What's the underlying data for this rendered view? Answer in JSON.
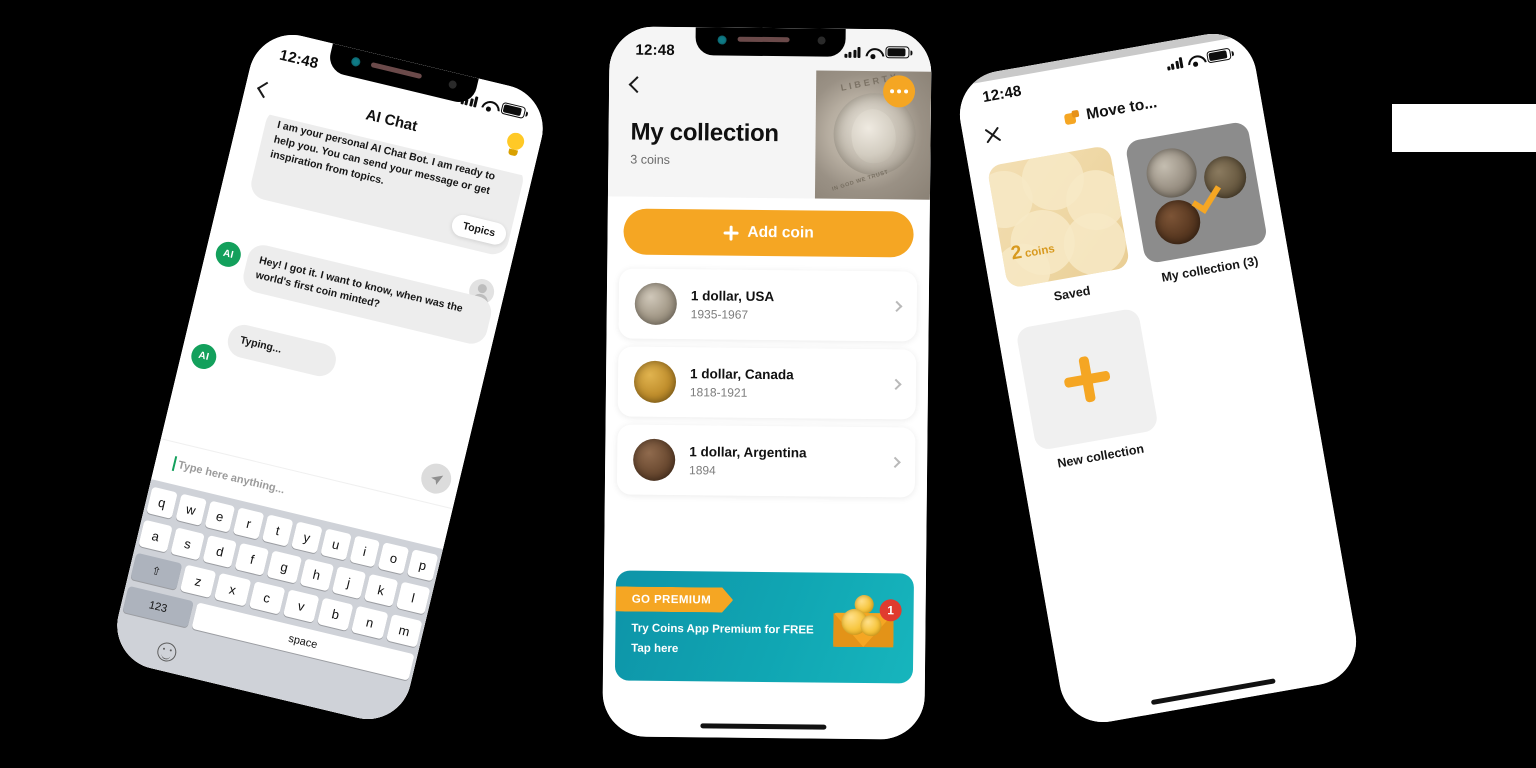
{
  "meta": {
    "background": "#000000",
    "accent_orange": "#F5A623",
    "accent_teal": "#10A6B3",
    "accent_green": "#13A05C"
  },
  "phone1": {
    "status": {
      "time": "12:48"
    },
    "header": {
      "title": "AI Chat",
      "back_icon": "chevron-left-icon",
      "bulb_icon": "lightbulb-icon"
    },
    "messages": [
      {
        "sender": "bot",
        "text": "I am your personal AI Chat Bot. I am ready to help you. You can send your message or get inspiration from topics."
      },
      {
        "sender": "user",
        "text": "Hey! I got it. I want to know, when was the world's first coin minted?"
      },
      {
        "sender": "bot",
        "text": "Typing..."
      }
    ],
    "topics_label": "Topics",
    "avatar_label": "AI",
    "input": {
      "placeholder": "Type here anything...",
      "value": ""
    },
    "send_icon": "send-paper-plane-icon",
    "keyboard": {
      "row1": [
        "q",
        "w",
        "e",
        "r",
        "t",
        "y",
        "u",
        "i",
        "o",
        "p"
      ],
      "row2": [
        "a",
        "s",
        "d",
        "f",
        "g",
        "h",
        "j",
        "k",
        "l"
      ],
      "row3": [
        "z",
        "x",
        "c",
        "v",
        "b",
        "n",
        "m"
      ],
      "shift_label": "⇧",
      "numbers_label": "123",
      "space_label": "space",
      "emoji_icon": "emoji-smiley-icon"
    }
  },
  "phone2": {
    "status": {
      "time": "12:48"
    },
    "back_icon": "chevron-left-icon",
    "more_icon": "more-horizontal-icon",
    "title": "My collection",
    "subtitle": "3 coins",
    "hero_coin": {
      "legend_top": "LIBERTY",
      "legend_bottom": "IN GOD WE TRUST"
    },
    "add_button": {
      "label": "Add coin",
      "icon": "plus-icon"
    },
    "coins": [
      {
        "name": "1 dollar, USA",
        "years": "1935-1967",
        "thumb": "coin-usa"
      },
      {
        "name": "1 dollar, Canada",
        "years": "1818-1921",
        "thumb": "coin-canada"
      },
      {
        "name": "1 dollar, Argentina",
        "years": "1894",
        "thumb": "coin-argentina"
      }
    ],
    "row_chevron_icon": "chevron-right-icon",
    "promo": {
      "ribbon": "GO PREMIUM",
      "line1": "Try Coins App Premium for FREE",
      "line2": "Tap here",
      "badge": "1",
      "icon": "envelope-with-coins-icon"
    }
  },
  "phone3": {
    "status": {
      "time": "12:48"
    },
    "close_icon": "close-x-icon",
    "header": {
      "title": "Move to...",
      "icon": "move-folder-icon"
    },
    "tiles": [
      {
        "label": "Saved",
        "count_number": "2",
        "count_word": "coins",
        "kind": "saved"
      },
      {
        "label": "My collection (3)",
        "kind": "collection",
        "selected": true,
        "check_icon": "check-icon"
      },
      {
        "label": "New collection",
        "kind": "new",
        "icon": "plus-icon"
      }
    ]
  }
}
